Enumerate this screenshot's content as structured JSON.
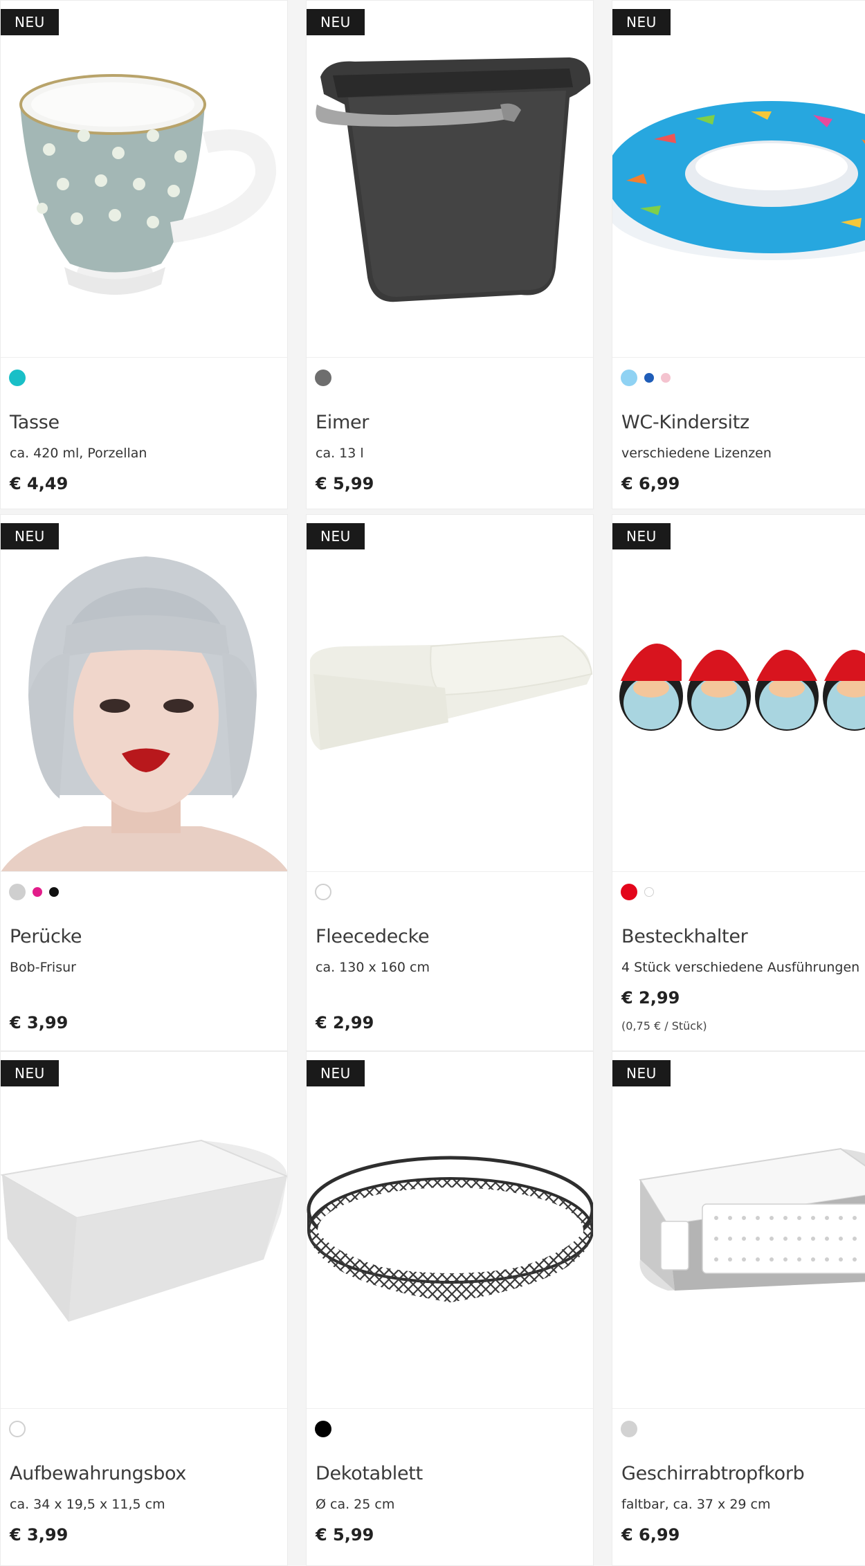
{
  "badge_label": "NEU",
  "products": [
    {
      "name": "Tasse",
      "desc": "ca. 420 ml, Porzellan",
      "price": "€ 4,49",
      "colors": [
        "#19bfc7"
      ]
    },
    {
      "name": "Eimer",
      "desc": "ca. 13 l",
      "price": "€ 5,99",
      "colors": [
        "#6e6e6e"
      ]
    },
    {
      "name": "WC-Kindersitz",
      "desc": "verschiedene Lizenzen",
      "price": "€ 6,99",
      "colors": [
        "#8fd2f3",
        "#1f5db8",
        "#f4c3cf"
      ]
    },
    {
      "name": "Perücke",
      "desc": "Bob-Frisur",
      "price": "€ 3,99",
      "colors": [
        "#cfcfcf",
        "#e21d8a",
        "#111111"
      ]
    },
    {
      "name": "Fleecedecke",
      "desc": "ca. 130 x 160 cm",
      "price": "€ 2,99",
      "colors": [
        "#ffffff"
      ]
    },
    {
      "name": "Besteckhalter",
      "desc": "4 Stück verschiedene Ausführungen",
      "price": "€ 2,99",
      "unit_price": "(0,75 € / Stück)",
      "colors": [
        "#e3061b",
        "#ffffff"
      ]
    },
    {
      "name": "Aufbewahrungsbox",
      "desc": "ca. 34 x 19,5 x 11,5 cm",
      "price": "€ 3,99",
      "colors": [
        "#ffffff"
      ]
    },
    {
      "name": "Dekotablett",
      "desc": "Ø ca. 25 cm",
      "price": "€ 5,99",
      "colors": [
        "#000000"
      ]
    },
    {
      "name": "Geschirrabtropfkorb",
      "desc": "faltbar, ca. 37 x 29 cm",
      "price": "€ 6,99",
      "colors": [
        "#d2d2d2"
      ]
    }
  ]
}
